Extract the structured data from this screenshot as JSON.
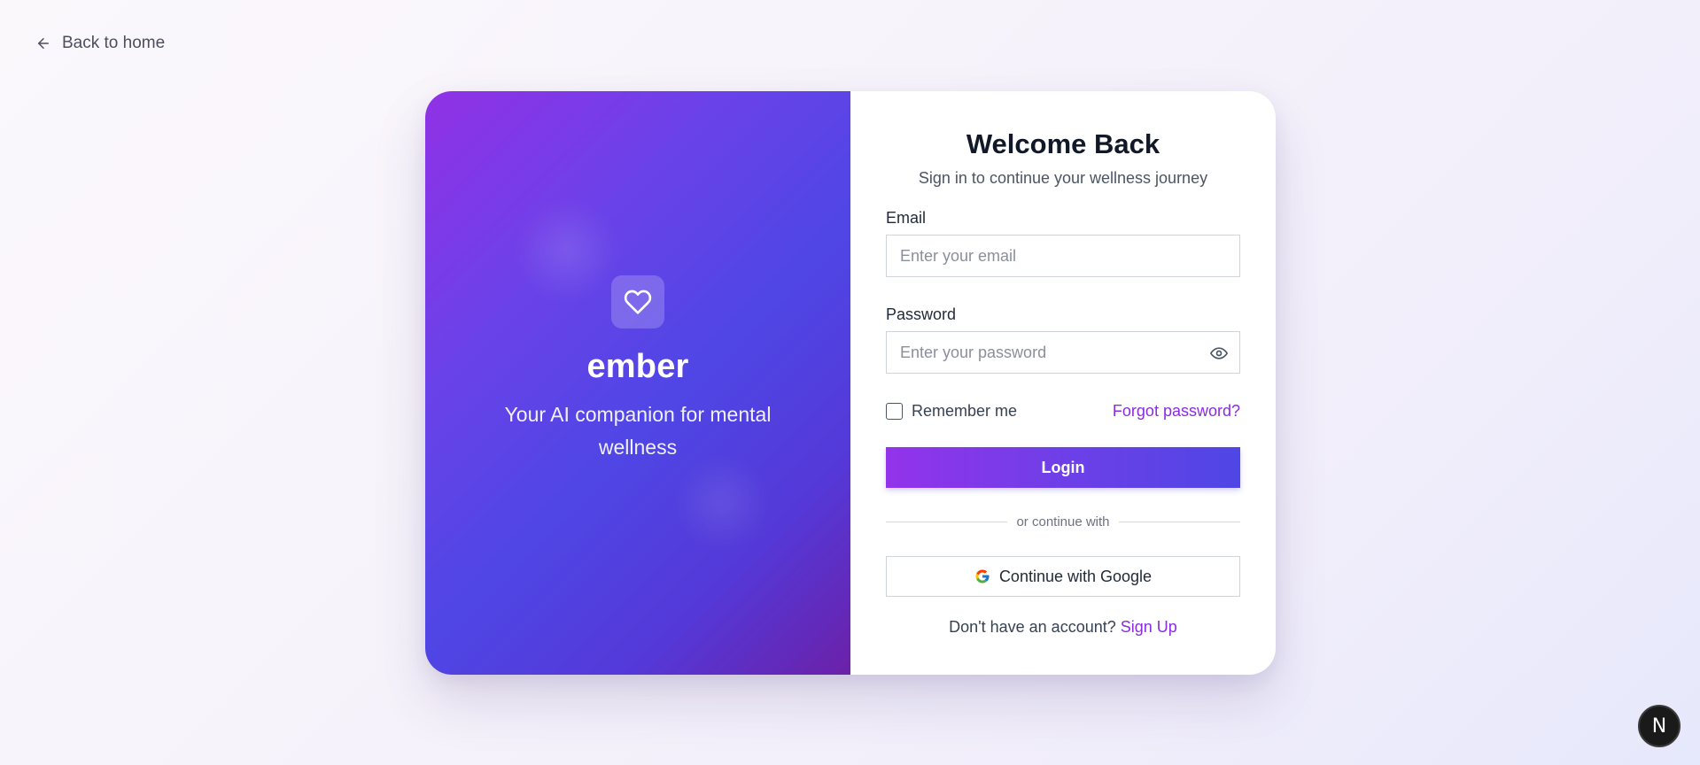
{
  "nav": {
    "back_label": "Back to home"
  },
  "brand": {
    "name": "ember",
    "tagline": "Your AI companion for mental wellness",
    "logo_icon": "heart-icon"
  },
  "form": {
    "title": "Welcome Back",
    "subtitle": "Sign in to continue your wellness journey",
    "email": {
      "label": "Email",
      "value": "",
      "placeholder": "Enter your email"
    },
    "password": {
      "label": "Password",
      "value": "",
      "placeholder": "Enter your password",
      "toggle_icon": "eye-icon"
    },
    "remember_label": "Remember me",
    "remember_checked": false,
    "forgot_label": "Forgot password?",
    "login_label": "Login",
    "divider_label": "or continue with",
    "google_label": "Continue with Google",
    "signup_prompt": "Don't have an account?",
    "signup_label": "Sign Up"
  },
  "dev_badge": {
    "label": "N"
  },
  "colors": {
    "accent": "#8b2be2",
    "gradient_start": "#9333ea",
    "gradient_end": "#4f46e5"
  }
}
